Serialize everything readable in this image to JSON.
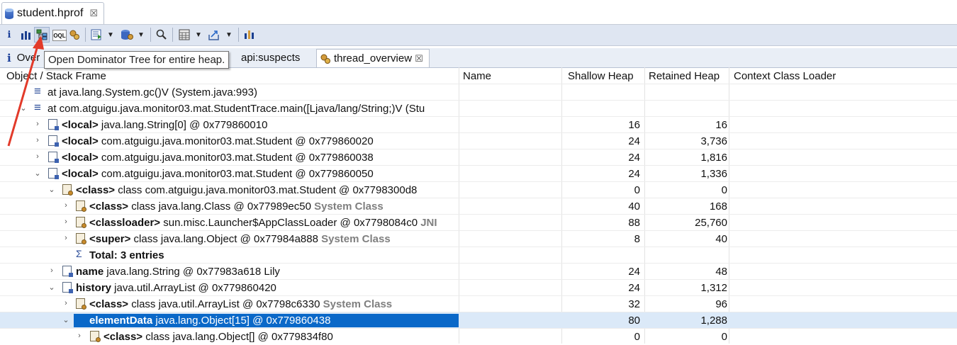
{
  "editor_tab": {
    "title": "student.hprof",
    "close": "☒"
  },
  "toolbar": {
    "items": [
      "info-icon",
      "histogram-icon",
      "dominator-tree-icon",
      "oql-icon",
      "thread-overview-icon",
      "query-browser-icon",
      "heap-dump-icon",
      "search-icon",
      "calculator-icon",
      "export-icon",
      "group-icon"
    ]
  },
  "tooltip": "Open Dominator Tree for entire heap.",
  "view_tabs": [
    {
      "label": "Over",
      "prefix": "i"
    },
    {
      "label": "api:suspects"
    },
    {
      "label": "thread_overview",
      "close": "☒"
    }
  ],
  "columns": [
    "Object / Stack Frame",
    "Name",
    "Shallow Heap",
    "Retained Heap",
    "Context Class Loader"
  ],
  "rows": [
    {
      "label": "at java.lang.System.gc()V (System.java:993)",
      "shallow": "",
      "retained": ""
    },
    {
      "label": "at com.atguigu.java.monitor03.mat.StudentTrace.main([Ljava/lang/String;)V (Stu",
      "shallow": "",
      "retained": ""
    },
    {
      "bold": "<local>",
      "label": " java.lang.String[0] @ 0x779860010",
      "shallow": "16",
      "retained": "16"
    },
    {
      "bold": "<local>",
      "label": " com.atguigu.java.monitor03.mat.Student @ 0x779860020",
      "shallow": "24",
      "retained": "3,736"
    },
    {
      "bold": "<local>",
      "label": " com.atguigu.java.monitor03.mat.Student @ 0x779860038",
      "shallow": "24",
      "retained": "1,816"
    },
    {
      "bold": "<local>",
      "label": " com.atguigu.java.monitor03.mat.Student @ 0x779860050",
      "shallow": "24",
      "retained": "1,336"
    },
    {
      "bold": "<class>",
      "label": " class com.atguigu.java.monitor03.mat.Student @ 0x7798300d8",
      "shallow": "0",
      "retained": "0"
    },
    {
      "bold": "<class>",
      "label": " class java.lang.Class @ 0x77989ec50 ",
      "sys": "System Class",
      "shallow": "40",
      "retained": "168"
    },
    {
      "bold": "<classloader>",
      "label": " sun.misc.Launcher$AppClassLoader @ 0x7798084c0 ",
      "sys": "JNI",
      "shallow": "88",
      "retained": "25,760"
    },
    {
      "bold": "<super>",
      "label": " class java.lang.Object @ 0x77984a888 ",
      "sys": "System Class",
      "shallow": "8",
      "retained": "40"
    },
    {
      "bold": "Total: 3 entries",
      "label": "",
      "shallow": "",
      "retained": ""
    },
    {
      "bold": "name",
      "label": " java.lang.String @ 0x77983a618  Lily",
      "shallow": "24",
      "retained": "48"
    },
    {
      "bold": "history",
      "label": " java.util.ArrayList @ 0x779860420",
      "shallow": "24",
      "retained": "1,312"
    },
    {
      "bold": "<class>",
      "label": " class java.util.ArrayList @ 0x7798c6330 ",
      "sys": "System Class",
      "shallow": "32",
      "retained": "96"
    },
    {
      "bold": "elementData",
      "label": " java.lang.Object[15] @ 0x779860438",
      "shallow": "80",
      "retained": "1,288"
    },
    {
      "bold": "<class>",
      "label": " class java.lang.Object[] @ 0x779834f80",
      "shallow": "0",
      "retained": "0"
    }
  ]
}
